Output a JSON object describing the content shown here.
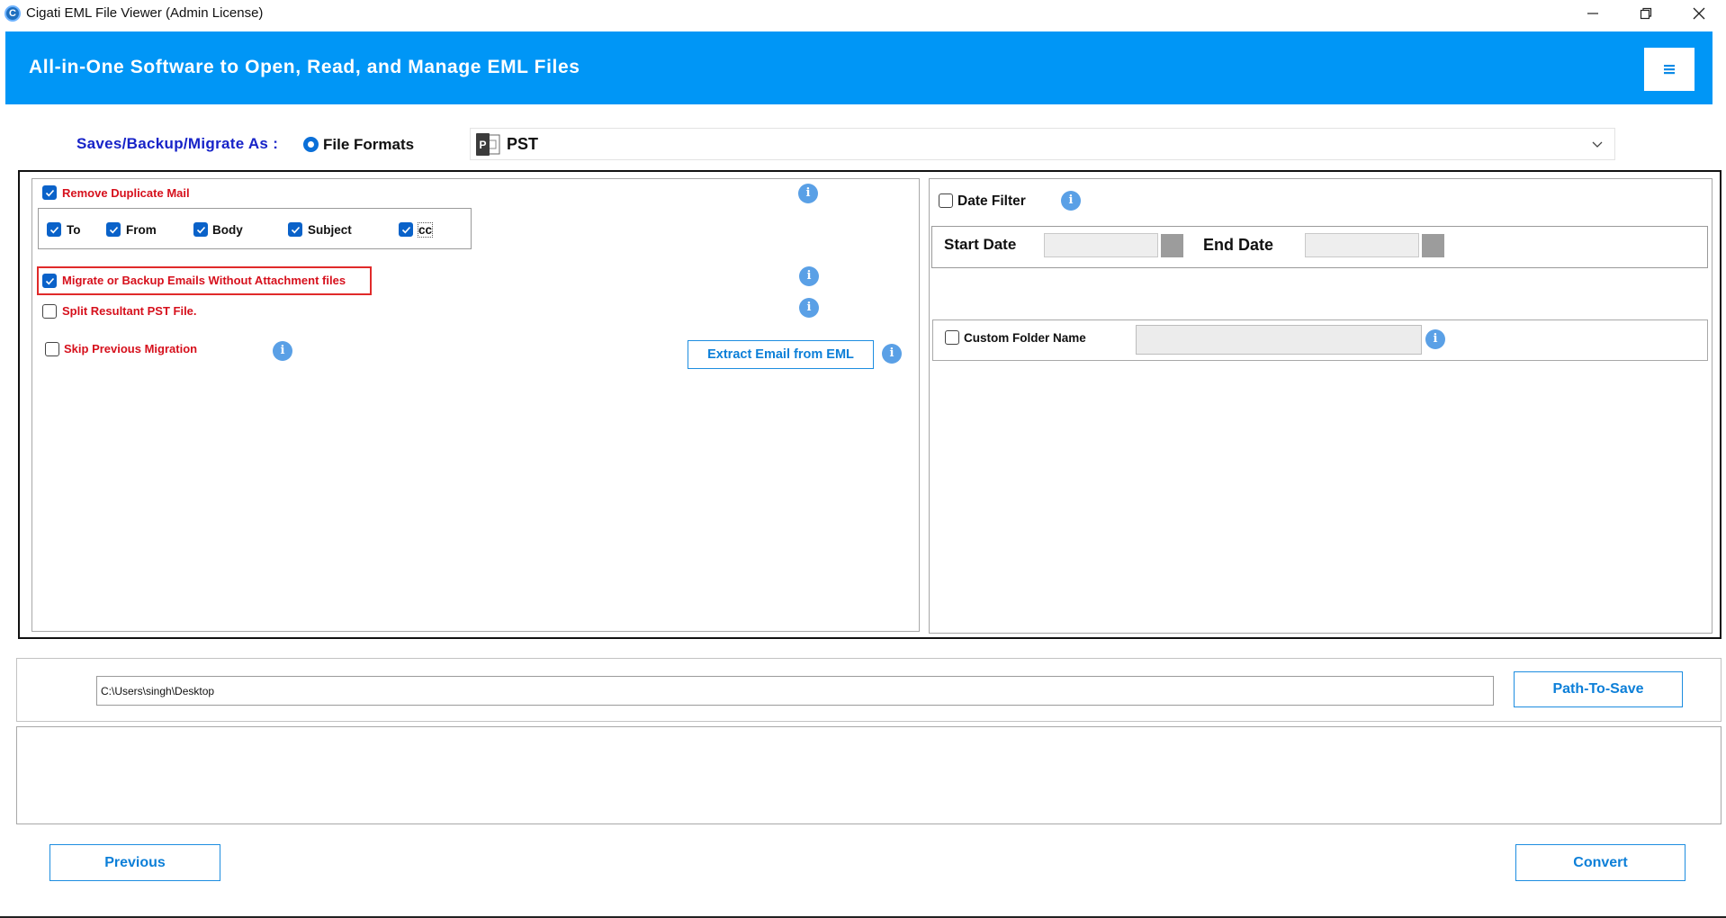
{
  "window": {
    "title": "Cigati EML File Viewer (Admin License)",
    "app_icon_letter": "C"
  },
  "header": {
    "title": "All-in-One Software to Open, Read, and Manage EML Files",
    "background": "#0096f6"
  },
  "saves": {
    "label": "Saves/Backup/Migrate As :",
    "option_label": "File Formats",
    "selected_format": "PST",
    "format_icon_letter": "P"
  },
  "left_options": {
    "remove_duplicate": {
      "label": "Remove Duplicate Mail",
      "checked": true
    },
    "dup_fields": [
      {
        "label": "To",
        "checked": true
      },
      {
        "label": "From",
        "checked": true
      },
      {
        "label": "Body",
        "checked": true
      },
      {
        "label": "Subject",
        "checked": true
      },
      {
        "label": "cc",
        "checked": true
      }
    ],
    "without_attachment": {
      "label": "Migrate or Backup Emails Without Attachment files",
      "checked": true
    },
    "split_pst": {
      "label": "Split Resultant PST File.",
      "checked": false
    },
    "skip_previous": {
      "label": "Skip Previous Migration",
      "checked": false
    },
    "extract_button": "Extract Email from EML"
  },
  "right_options": {
    "date_filter": {
      "label": "Date Filter",
      "checked": false
    },
    "start_date_label": "Start Date",
    "end_date_label": "End Date",
    "custom_folder": {
      "label": "Custom Folder Name",
      "checked": false
    }
  },
  "info_icon_glyph": "i",
  "path": {
    "value": "C:\\Users\\singh\\Desktop",
    "button": "Path-To-Save"
  },
  "nav": {
    "previous": "Previous",
    "convert": "Convert"
  },
  "colors": {
    "accent": "#0096f6",
    "checkbox": "#0a62c9",
    "warning_red": "#d6101c",
    "label_blue": "#1723c8",
    "button_text": "#0c7fd8"
  }
}
